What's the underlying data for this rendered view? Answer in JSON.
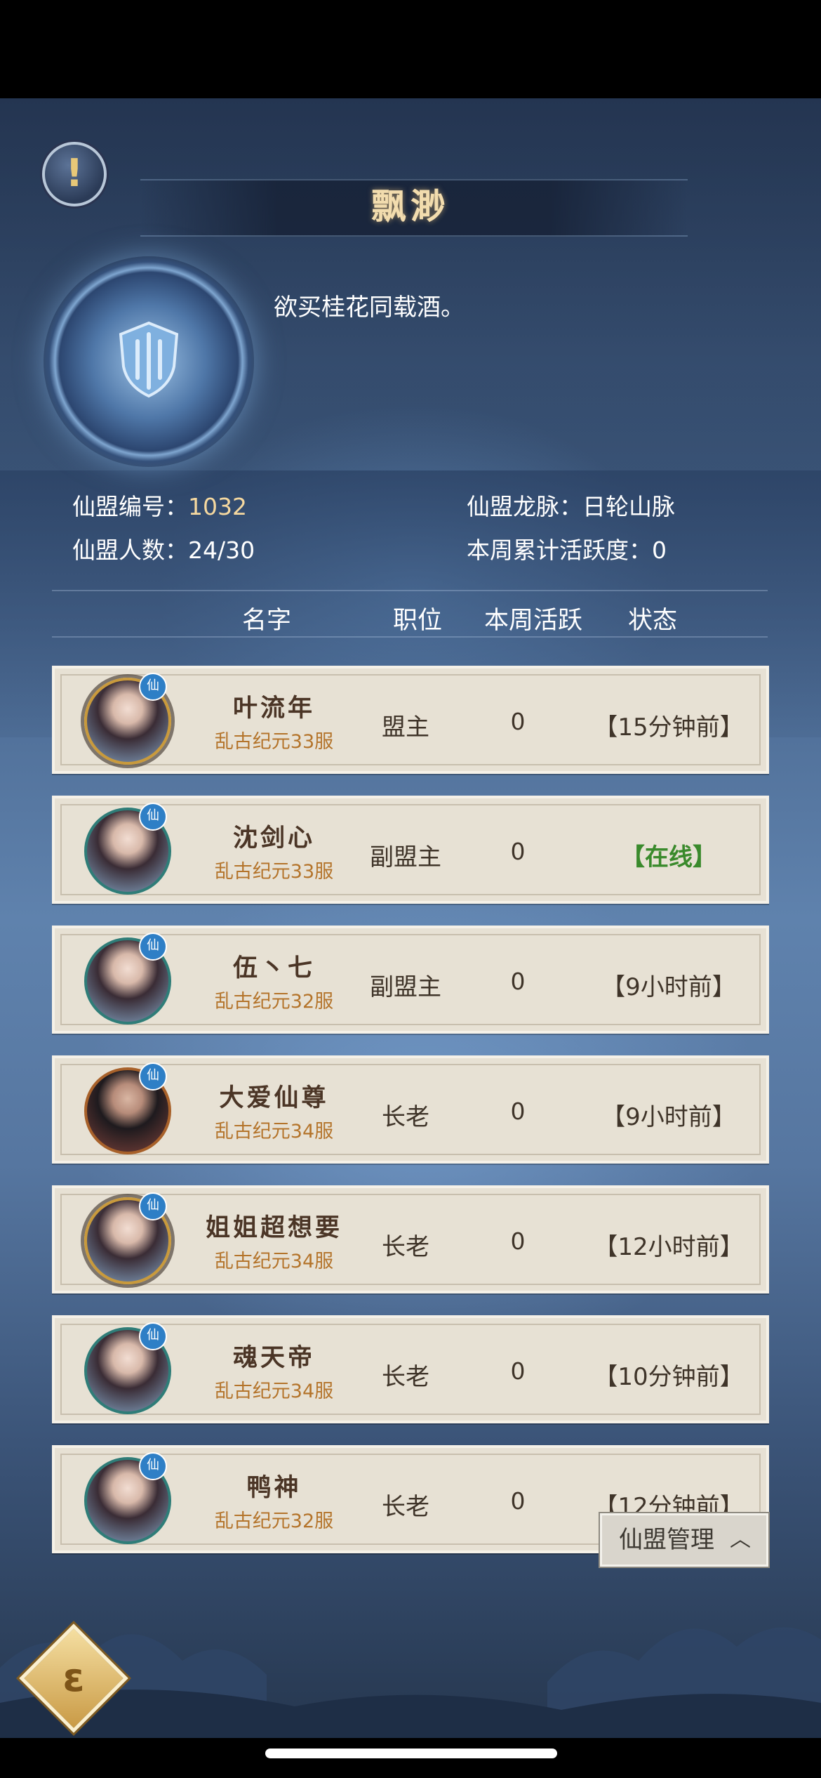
{
  "guild": {
    "name": "飘渺",
    "motto": "欲买桂花同载酒。",
    "id_label": "仙盟编号：",
    "id_value": "1032",
    "members_label": "仙盟人数：",
    "members_value": "24/30",
    "vein_label": "仙盟龙脉：",
    "vein_value": "日轮山脉",
    "activity_label": "本周累计活跃度：",
    "activity_value": "0"
  },
  "table": {
    "headers": [
      "名字",
      "职位",
      "本周活跃",
      "状态"
    ],
    "rows": [
      {
        "name": "叶流年",
        "server": "乱古纪元33服",
        "role": "盟主",
        "activity": "0",
        "status": "【15分钟前】",
        "online": false
      },
      {
        "name": "沈剑心",
        "server": "乱古纪元33服",
        "role": "副盟主",
        "activity": "0",
        "status": "【在线】",
        "online": true
      },
      {
        "name": "伍丶七",
        "server": "乱古纪元32服",
        "role": "副盟主",
        "activity": "0",
        "status": "【9小时前】",
        "online": false
      },
      {
        "name": "大爱仙尊",
        "server": "乱古纪元34服",
        "role": "长老",
        "activity": "0",
        "status": "【9小时前】",
        "online": false
      },
      {
        "name": "姐姐超想要",
        "server": "乱古纪元34服",
        "role": "长老",
        "activity": "0",
        "status": "【12小时前】",
        "online": false
      },
      {
        "name": "魂天帝",
        "server": "乱古纪元34服",
        "role": "长老",
        "activity": "0",
        "status": "【10分钟前】",
        "online": false
      },
      {
        "name": "鸭神",
        "server": "乱古纪元32服",
        "role": "长老",
        "activity": "0",
        "status": "【12分钟前】",
        "online": false
      }
    ]
  },
  "avatar_badge": "仙",
  "manage_button": {
    "label": "仙盟管理",
    "icon": "chevron-up-icon"
  },
  "info_button": {
    "glyph": "!",
    "icon": "info-icon"
  },
  "back_button": {
    "icon": "back-swirl-icon"
  },
  "colors": {
    "online": "#3a8a2c",
    "server": "#b4742b",
    "title_gold": "#f2dcae",
    "row_bg": "#e7e1d4"
  }
}
